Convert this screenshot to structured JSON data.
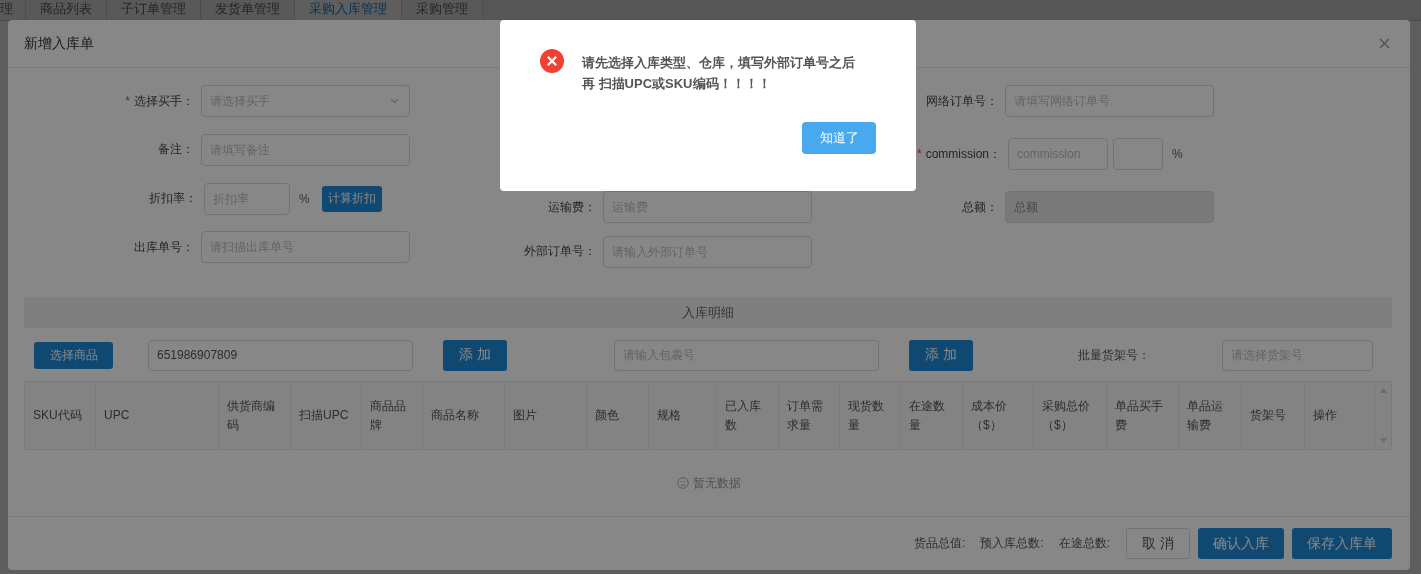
{
  "background_tabs": [
    {
      "label": "理",
      "selected": false
    },
    {
      "label": "商品列表",
      "selected": false
    },
    {
      "label": "子订单管理",
      "selected": false
    },
    {
      "label": "发货单管理",
      "selected": false
    },
    {
      "label": "采购入库管理",
      "selected": true
    },
    {
      "label": "采购管理",
      "selected": false
    }
  ],
  "modal": {
    "title": "新增入库单",
    "form_columns": [
      {
        "fields": [
          {
            "kind": "select",
            "label": "选择买手：",
            "required_mark": "*",
            "placeholder": "请选择买手",
            "disabled": false
          },
          {
            "kind": "text",
            "label": "备注：",
            "placeholder": "请填写备注",
            "disabled": false
          },
          {
            "kind": "rate",
            "label": "折扣率：",
            "placeholder": "折扣率",
            "disabled": false,
            "unit": "%",
            "button": "计算折扣"
          },
          {
            "kind": "text",
            "label": "出库单号：",
            "placeholder": "请扫描出库单号",
            "disabled": false
          }
        ]
      },
      {
        "fields": [
          {
            "kind": "text",
            "label": "运输费：",
            "placeholder": "运输费",
            "disabled": false
          },
          {
            "kind": "text",
            "label": "外部订单号：",
            "placeholder": "请输入外部订单号",
            "disabled": false
          }
        ]
      },
      {
        "fields": [
          {
            "kind": "text",
            "label": "网络订单号：",
            "placeholder": "请填写网络订单号",
            "disabled": false
          },
          {
            "kind": "commission",
            "label": "commission：",
            "required_mark": "*",
            "placeholder": "commission",
            "disabled": false,
            "unit": "%"
          },
          {
            "kind": "text",
            "label": "总额：",
            "placeholder": "总额",
            "disabled": true
          }
        ]
      }
    ],
    "detail": {
      "title": "入库明细",
      "toolbar": [
        {
          "kind": "button",
          "label": "选择商品"
        },
        {
          "kind": "input",
          "value": "651986907809"
        },
        {
          "kind": "big_button",
          "label": "添 加"
        },
        {
          "kind": "input",
          "placeholder": "请输入包裹号"
        },
        {
          "kind": "big_button",
          "label": "添 加"
        },
        {
          "kind": "label",
          "label": "批量货架号："
        },
        {
          "kind": "input",
          "placeholder": "请选择货架号"
        }
      ],
      "columns": [
        "SKU代码",
        "UPC",
        "供货商编码",
        "扫描UPC",
        "商品品牌",
        "商品名称",
        "图片",
        "颜色",
        "规格",
        "已入库数",
        "订单需求量",
        "现货数量",
        "在途数量",
        "成本价（$）",
        "采购总价（$）",
        "单品买手费",
        "单品运输费",
        "货架号",
        "操作"
      ],
      "empty_text": "暂无数据"
    },
    "footer": {
      "totals": [
        "货品总值:",
        "预入库总数:",
        "在途总数:"
      ],
      "buttons": [
        {
          "label": "取 消",
          "kind": "default"
        },
        {
          "label": "确认入库",
          "kind": "primary"
        },
        {
          "label": "保存入库单",
          "kind": "primary"
        }
      ]
    }
  },
  "alert": {
    "kind": "error",
    "message_lines": [
      "请先选择入库类型、仓库，填写外部订单号之后",
      "再 扫描UPC或SKU编码！！！！"
    ],
    "button": "知道了"
  }
}
